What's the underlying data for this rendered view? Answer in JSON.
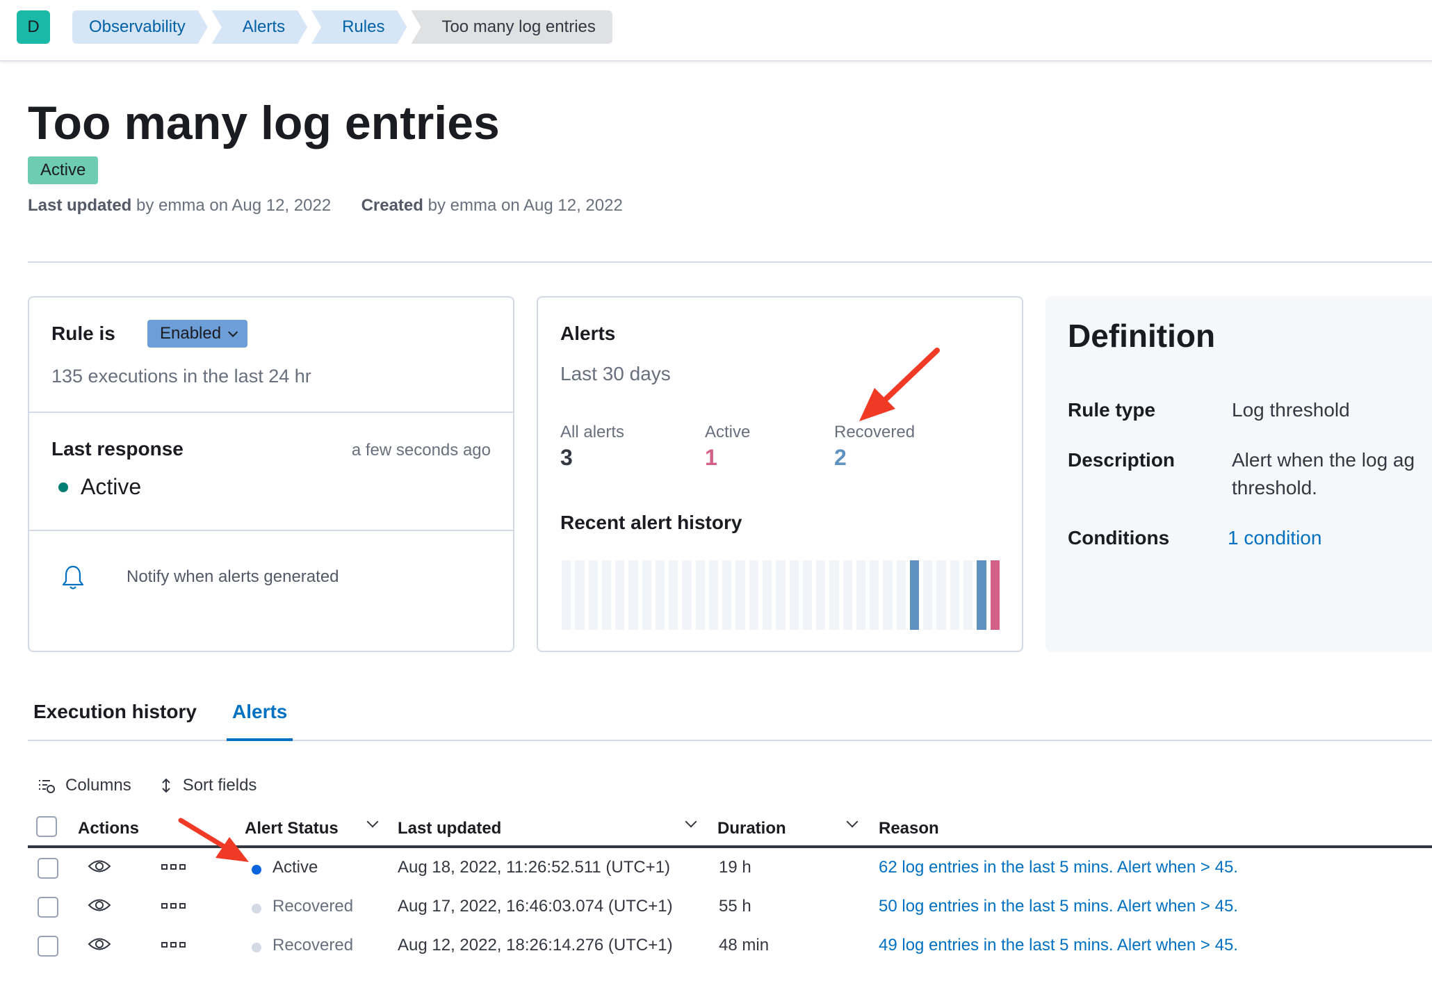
{
  "header": {
    "avatar_letter": "D",
    "breadcrumbs": [
      "Observability",
      "Alerts",
      "Rules",
      "Too many log entries"
    ]
  },
  "page": {
    "title": "Too many log entries",
    "status": "Active",
    "last_updated_label": "Last updated",
    "last_updated_text": "by emma on Aug 12, 2022",
    "created_label": "Created",
    "created_text": "by emma on Aug 12, 2022"
  },
  "rule_panel": {
    "rule_is_label": "Rule is",
    "enabled_label": "Enabled",
    "executions": "135 executions in the last 24 hr",
    "last_response_label": "Last response",
    "last_response_time": "a few seconds ago",
    "last_response_status": "Active",
    "notify_text": "Notify when alerts generated"
  },
  "alerts_panel": {
    "title": "Alerts",
    "period": "Last 30 days",
    "stats": [
      {
        "label": "All alerts",
        "value": "3",
        "color": "#343741"
      },
      {
        "label": "Active",
        "value": "1",
        "color": "#d36086"
      },
      {
        "label": "Recovered",
        "value": "2",
        "color": "#6092c0"
      }
    ],
    "history_label": "Recent alert history",
    "history": [
      "none",
      "none",
      "none",
      "none",
      "none",
      "none",
      "none",
      "none",
      "none",
      "none",
      "none",
      "none",
      "none",
      "none",
      "none",
      "none",
      "none",
      "none",
      "none",
      "none",
      "none",
      "none",
      "none",
      "none",
      "none",
      "none",
      "recovered",
      "none",
      "none",
      "none",
      "none",
      "recovered",
      "active"
    ],
    "colors": {
      "none": "#f1f4f9",
      "recovered": "#6092c0",
      "active": "#d36086"
    }
  },
  "definition": {
    "title": "Definition",
    "rule_type_label": "Rule type",
    "rule_type": "Log threshold",
    "description_label": "Description",
    "description_line1": "Alert when the log ag",
    "description_line2": "threshold.",
    "conditions_label": "Conditions",
    "conditions": "1 condition"
  },
  "tabs": [
    "Execution history",
    "Alerts"
  ],
  "toolbar": {
    "columns": "Columns",
    "sort_fields": "Sort fields"
  },
  "table": {
    "headers": [
      "Actions",
      "Alert Status",
      "Last updated",
      "Duration",
      "Reason"
    ],
    "rows": [
      {
        "status": "Active",
        "status_color": "#0b64dd",
        "last_updated": "Aug 18, 2022, 11:26:52.511 (UTC+1)",
        "duration": "19 h",
        "reason": "62 log entries in the last 5 mins. Alert when > 45."
      },
      {
        "status": "Recovered",
        "status_color": "#d3dae6",
        "last_updated": "Aug 17, 2022, 16:46:03.074 (UTC+1)",
        "duration": "55 h",
        "reason": "50 log entries in the last 5 mins. Alert when > 45."
      },
      {
        "status": "Recovered",
        "status_color": "#d3dae6",
        "last_updated": "Aug 12, 2022, 18:26:14.276 (UTC+1)",
        "duration": "48 min",
        "reason": "49 log entries in the last 5 mins. Alert when > 45."
      }
    ]
  },
  "accent_colors": {
    "link": "#0071c2",
    "status_green": "#017d73",
    "annotation_arrow": "#f03a26"
  }
}
